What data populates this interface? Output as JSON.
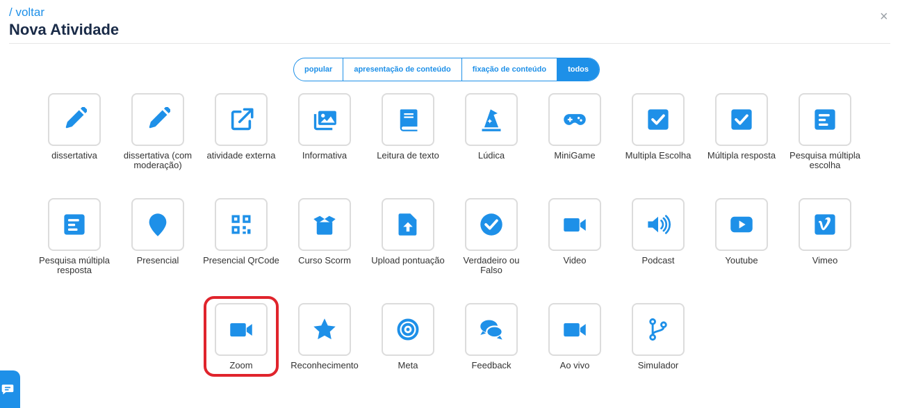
{
  "header": {
    "back_label": "/ voltar",
    "title": "Nova Atividade",
    "close_label": "×"
  },
  "filters": [
    {
      "label": "popular",
      "active": false
    },
    {
      "label": "apresentação de conteúdo",
      "active": false
    },
    {
      "label": "fixação de conteúdo",
      "active": false
    },
    {
      "label": "todos",
      "active": true
    }
  ],
  "activities": [
    {
      "label": "dissertativa",
      "icon": "pencil-icon"
    },
    {
      "label": "dissertativa (com moderação)",
      "icon": "pencil-icon"
    },
    {
      "label": "atividade externa",
      "icon": "external-link-icon"
    },
    {
      "label": "Informativa",
      "icon": "images-icon"
    },
    {
      "label": "Leitura de texto",
      "icon": "book-icon"
    },
    {
      "label": "Lúdica",
      "icon": "wizard-hat-icon"
    },
    {
      "label": "MiniGame",
      "icon": "gamepad-icon"
    },
    {
      "label": "Multipla Escolha",
      "icon": "checkbox-icon"
    },
    {
      "label": "Múltipla resposta",
      "icon": "checkbox-icon"
    },
    {
      "label": "Pesquisa múltipla escolha",
      "icon": "poll-icon"
    },
    {
      "label": "Pesquisa múltipla resposta",
      "icon": "poll-icon"
    },
    {
      "label": "Presencial",
      "icon": "map-marker-icon"
    },
    {
      "label": "Presencial QrCode",
      "icon": "qrcode-icon"
    },
    {
      "label": "Curso Scorm",
      "icon": "box-open-icon"
    },
    {
      "label": "Upload pontuação",
      "icon": "file-upload-icon"
    },
    {
      "label": "Verdadeiro ou Falso",
      "icon": "check-circle-icon"
    },
    {
      "label": "Video",
      "icon": "video-icon"
    },
    {
      "label": "Podcast",
      "icon": "volume-icon"
    },
    {
      "label": "Youtube",
      "icon": "youtube-icon"
    },
    {
      "label": "Vimeo",
      "icon": "vimeo-icon"
    },
    {
      "label": "Zoom",
      "icon": "video-icon"
    },
    {
      "label": "Reconhecimento",
      "icon": "star-icon"
    },
    {
      "label": "Meta",
      "icon": "target-icon"
    },
    {
      "label": "Feedback",
      "icon": "comments-icon"
    },
    {
      "label": "Ao vivo",
      "icon": "video-icon"
    },
    {
      "label": "Simulador",
      "icon": "code-branch-icon"
    }
  ],
  "highlighted_activity": "Zoom",
  "colors": {
    "accent": "#1e90e8",
    "title": "#1a2b48",
    "highlight": "#e0242c",
    "tile_border": "#dcdcdc"
  }
}
